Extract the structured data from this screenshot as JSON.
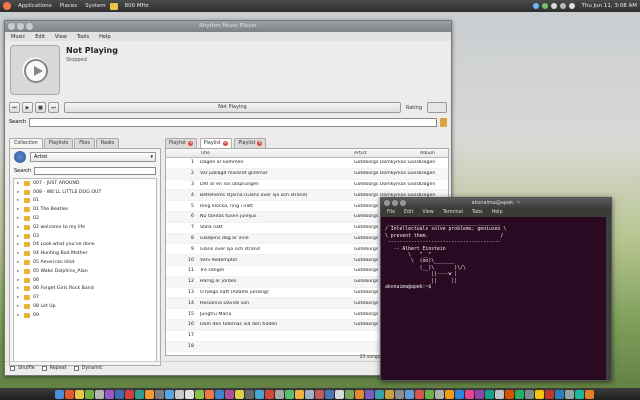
{
  "top_panel": {
    "menus": [
      "Applications",
      "Places",
      "System"
    ],
    "cpu": "800 MHz",
    "clock": "Thu Jun 11, 3:08 AM"
  },
  "rhythmbox": {
    "window_title": "Rhythm Music Player",
    "menu": [
      "Music",
      "Edit",
      "View",
      "Tools",
      "Help"
    ],
    "now_playing": "Not Playing",
    "status": "Stopped",
    "progress_label": "Not Playing",
    "rating_label": "Rating",
    "search_label": "Search",
    "browser_tabs": [
      "Collection",
      "Playlists",
      "Files",
      "Radio"
    ],
    "artist_combo": "Artist",
    "filter_label": "Search",
    "albums": [
      "007 - JUST AROUND",
      "008 - WE'LL LITTLE DOG OUT",
      "01",
      "01 The Beatles",
      "02",
      "02 welcome to my life",
      "03",
      "04 Look what you've done",
      "04 Hunting Bad Mother",
      "05 American Idiot",
      "05 Wake Dolphins_Alan",
      "06",
      "06 Forget Girls Rock Band",
      "07",
      "08 Let Up",
      "09"
    ],
    "playlist_tabs": [
      "Playlist",
      "Playlist",
      "Playlist"
    ],
    "columns": {
      "num": "",
      "title": "Title",
      "artist": "Artist",
      "album": "Album"
    },
    "tracks": [
      {
        "num": "1",
        "title": "Dagen är kommen",
        "artist": "Göteborgs Domkyrkas Gosskör",
        "album": "Dagen"
      },
      {
        "num": "2",
        "title": "Var jublagd mörkret glimmar",
        "artist": "Göteborgs Domkyrkas Gosskör",
        "album": "Dagen"
      },
      {
        "num": "3",
        "title": "Det är en ros utsprungen",
        "artist": "Göteborgs Domkyrkas Gosskör",
        "album": "Dagen"
      },
      {
        "num": "4",
        "title": "Betlehems stjärna (Gläns över sjö och strand)",
        "artist": "Göteborgs Domkyrkas Gosskör",
        "album": "Dagen"
      },
      {
        "num": "5",
        "title": "Ring klocka, ring i natt",
        "artist": "Göteborgs Domkyrkas Gosskör",
        "album": "Dagen"
      },
      {
        "num": "6",
        "title": "Nu tändas tusen juleljus",
        "artist": "Göteborgs Domkyrkas Gosskör",
        "album": "Dagen"
      },
      {
        "num": "7",
        "title": "Stilla natt",
        "artist": "Göteborgs Domkyrkas Gosskör",
        "album": "Dagen"
      },
      {
        "num": "8",
        "title": "Glädjens dag är inne",
        "artist": "Göteborgs Domkyrkas Gosskör",
        "album": "Dagen"
      },
      {
        "num": "9",
        "title": "Gläns över sjö och strand",
        "artist": "Göteborgs Domkyrkas Gosskör",
        "album": "Dagen"
      },
      {
        "num": "10",
        "title": "Veni Redemptor",
        "artist": "Göteborgs Domkyrkas Gosskör",
        "album": "Dagen"
      },
      {
        "num": "11",
        "title": "Tre sånger",
        "artist": "Göteborgs Domkyrkas Gosskör",
        "album": "Dagen"
      },
      {
        "num": "12",
        "title": "Härlig är jorden",
        "artist": "Göteborgs Domkyrkas Gosskör",
        "album": "Dagen"
      },
      {
        "num": "13",
        "title": "O helga natt (Adams julsång)",
        "artist": "Göteborgs Domkyrkas Gosskör",
        "album": "Dagen"
      },
      {
        "num": "14",
        "title": "Hosianna Davids son",
        "artist": "Göteborgs Domkyrkas Gosskör",
        "album": "Dagen"
      },
      {
        "num": "15",
        "title": "Jungfru Maria",
        "artist": "Göteborgs Domkyrkas Gosskör",
        "album": "Dagen"
      },
      {
        "num": "16",
        "title": "Dom den tidernas vid den tidden",
        "artist": "Göteborgs Domkyrkas Gosskör",
        "album": "Dagen"
      },
      {
        "num": "17",
        "title": "",
        "artist": "",
        "album": ""
      },
      {
        "num": "18",
        "title": "",
        "artist": "",
        "album": ""
      }
    ],
    "status_count": "25 songs, 1 hour, 25 minutes, 92.0 MB",
    "shuffle": "Shuffle",
    "repeat": "Repeat",
    "dynamic": "Dynamic",
    "vol": "Vol"
  },
  "terminal": {
    "title": "akonaima@apek: ~",
    "menu": [
      "File",
      "Edit",
      "View",
      "Terminal",
      "Tabs",
      "Help"
    ],
    "lines": [
      " _______________________________________",
      "/ Intellectuals solve problems; geniuses \\",
      "\\ prevent them.                         /",
      " ---------------------------------------",
      "   -- Albert Einstein",
      "",
      "        \\   ^__^",
      "         \\  (oo)\\_______",
      "            (__)\\       )\\/\\",
      "                ||----w |",
      "                ||     ||",
      "akonaima@apek:~$ "
    ]
  },
  "colors": {
    "accent": "#f07746",
    "terminal_bg": "#2a0a22",
    "panel": "#3a3a3a"
  }
}
